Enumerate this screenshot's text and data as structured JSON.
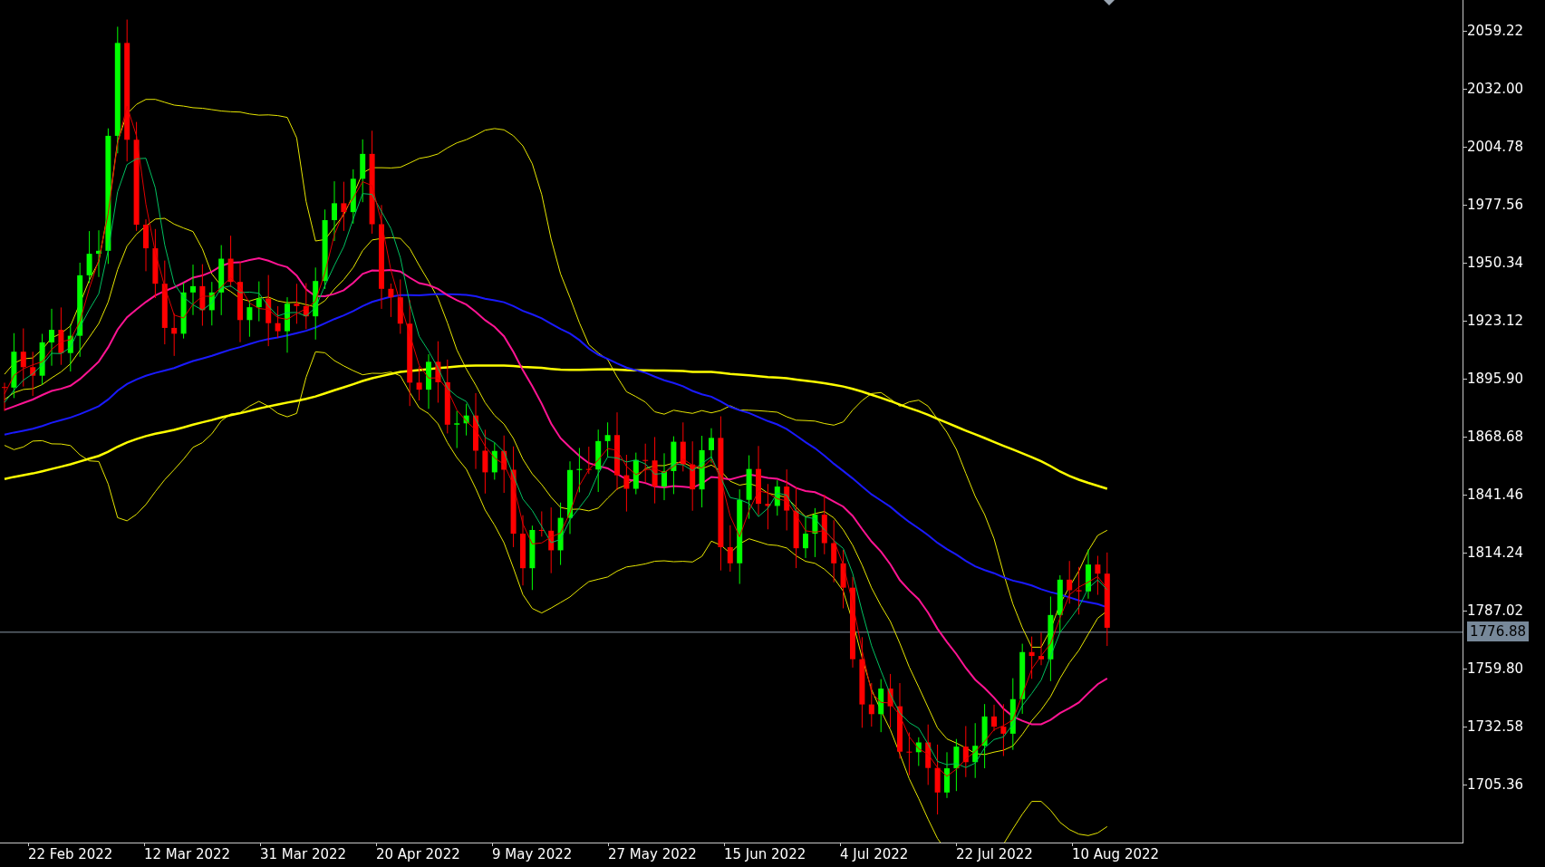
{
  "price_axis": {
    "labels": [
      "2059.22",
      "2032.00",
      "2004.78",
      "1977.56",
      "1950.34",
      "1923.12",
      "1895.90",
      "1868.68",
      "1841.46",
      "1814.24",
      "1787.02",
      "1759.80",
      "1732.58",
      "1705.36"
    ]
  },
  "current_price": {
    "label": "1776.88"
  },
  "time_axis": {
    "labels": [
      "22 Feb 2022",
      "12 Mar 2022",
      "31 Mar 2022",
      "20 Apr 2022",
      "9 May 2022",
      "27 May 2022",
      "15 Jun 2022",
      "4 Jul 2022",
      "22 Jul 2022",
      "10 Aug 2022"
    ]
  }
}
